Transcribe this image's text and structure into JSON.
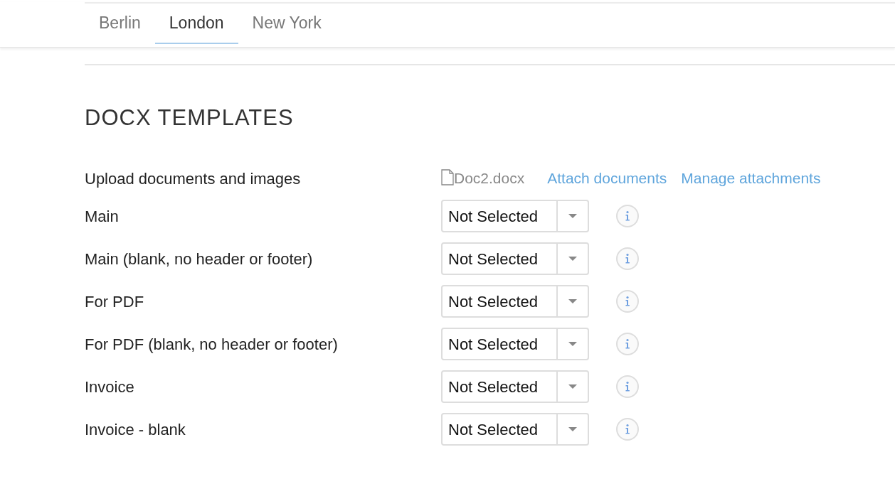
{
  "tabs": [
    {
      "label": "Berlin",
      "selected": false
    },
    {
      "label": "London",
      "selected": true
    },
    {
      "label": "New York",
      "selected": false
    }
  ],
  "section": {
    "title": "DOCX TEMPLATES",
    "upload": {
      "label": "Upload documents and images",
      "file": "Doc2.docx",
      "links": [
        "Attach documents",
        "Manage attachments"
      ]
    },
    "templates": [
      {
        "label": "Main",
        "value": "Not Selected"
      },
      {
        "label": "Main (blank, no header or footer)",
        "value": "Not Selected"
      },
      {
        "label": "For PDF",
        "value": "Not Selected"
      },
      {
        "label": "For PDF (blank, no header or footer)",
        "value": "Not Selected"
      },
      {
        "label": "Invoice",
        "value": "Not Selected"
      },
      {
        "label": "Invoice - blank",
        "value": "Not Selected"
      }
    ]
  }
}
